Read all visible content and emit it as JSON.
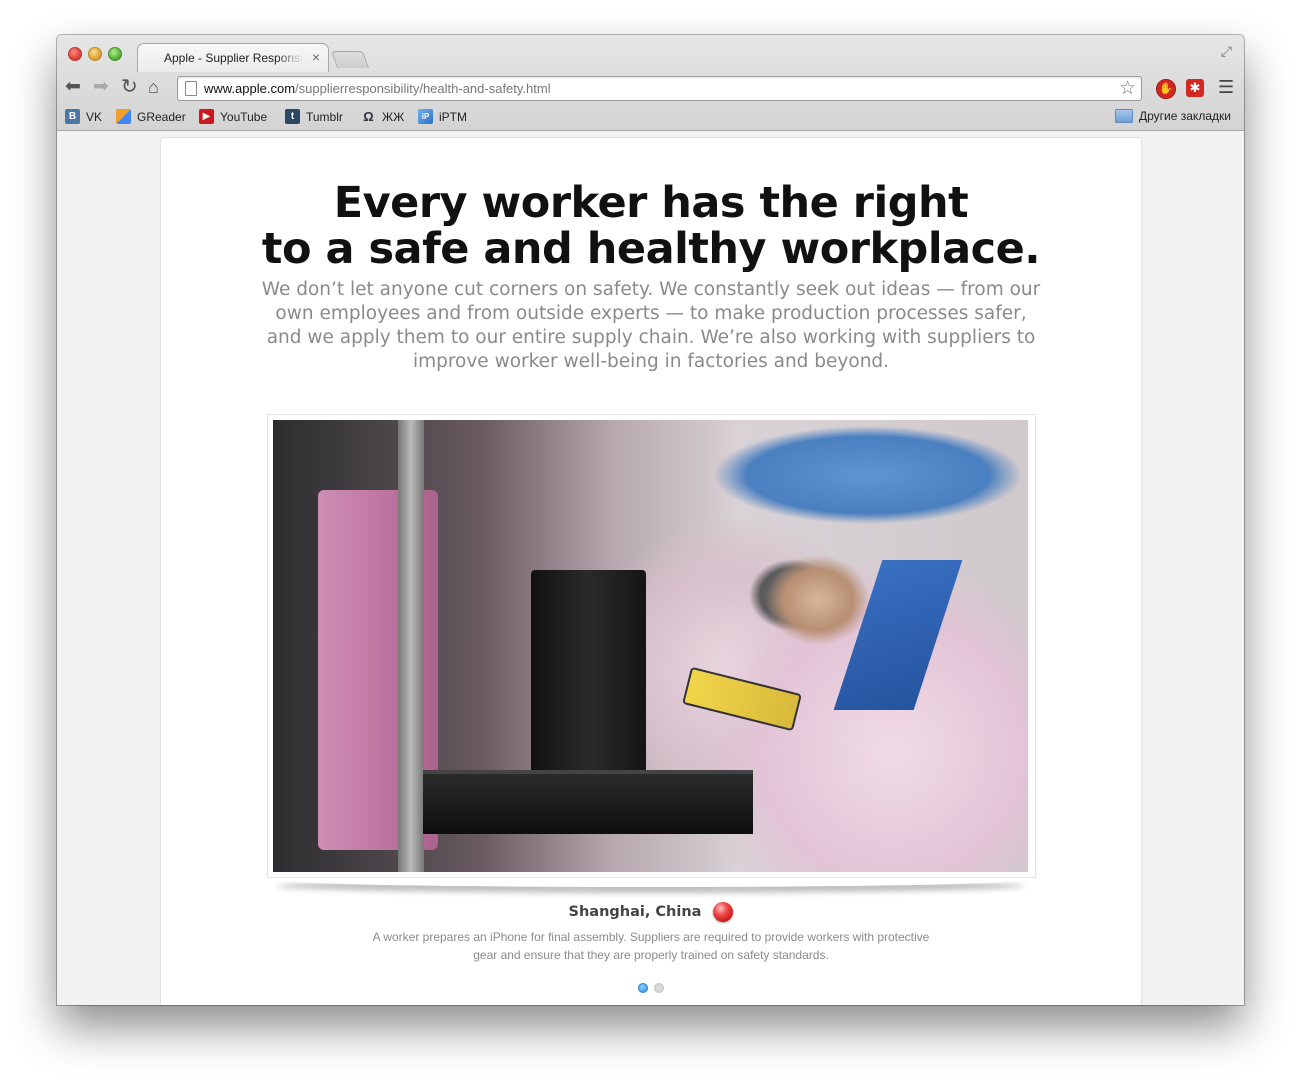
{
  "tab": {
    "title": "Apple - Supplier Responsibility",
    "close_glyph": "×"
  },
  "omnibox": {
    "host": "www.apple.com",
    "path": "/supplierresponsibility/health-and-safety.html"
  },
  "bookmarks": [
    {
      "label": "VK",
      "icon": "vk-icon"
    },
    {
      "label": "GReader",
      "icon": "greader-icon"
    },
    {
      "label": "YouTube",
      "icon": "youtube-icon"
    },
    {
      "label": "Tumblr",
      "icon": "tumblr-icon"
    },
    {
      "label": "ЖЖ",
      "icon": "livejournal-icon"
    },
    {
      "label": "iPTM",
      "icon": "iptm-icon"
    }
  ],
  "other_bookmarks": "Другие закладки",
  "page": {
    "headline_line1": "Every worker has the right",
    "headline_line2": "to a safe and healthy workplace.",
    "intro": "We don’t let anyone cut corners on safety. We constantly seek out ideas — from our own employees and from outside experts — to make production processes safer, and we apply them to our entire supply chain. We’re also working with suppliers to improve worker well-being in factories and beyond.",
    "caption_place": "Shanghai, China",
    "caption_text": "A worker prepares an iPhone for final assembly. Suppliers are required to provide workers with protective gear and ensure that they are properly trained on safety standards.",
    "slides_total": 2,
    "slide_active": 1
  },
  "colors": {
    "accent_blue": "#2a8ee8",
    "pin_red": "#e0302f",
    "intro_gray": "#8a8a8a"
  }
}
